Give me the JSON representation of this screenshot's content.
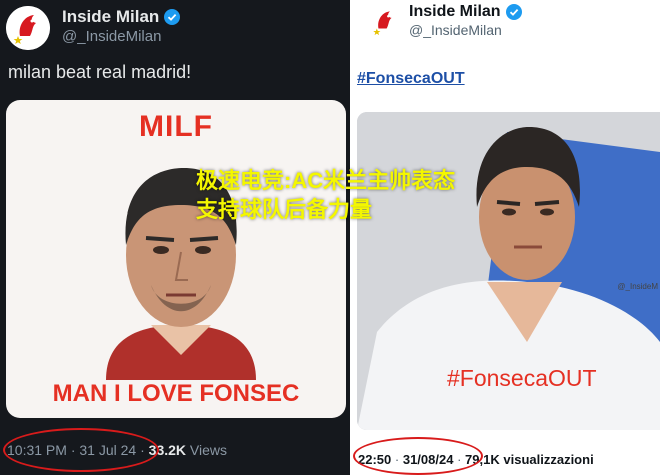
{
  "left_tweet": {
    "account_name": "Inside Milan",
    "handle": "@_InsideMilan",
    "text": "milan beat real madrid!",
    "meme_title": "MILF",
    "meme_caption": "MAN I LOVE FONSEC",
    "time": "10:31 PM",
    "separator": "·",
    "date": "31 Jul 24",
    "views_count": "33.2K",
    "views_label": "Views"
  },
  "right_tweet": {
    "account_name": "Inside Milan",
    "handle": "@_InsideMilan",
    "hashtag": "#FonsecaOUT",
    "photo_hashtag": "#FonsecaOUT",
    "watermark": "@_InsideM",
    "time": "22:50",
    "separator": "·",
    "date": "31/08/24",
    "views_count": "79,1K",
    "views_label": "visualizzazioni"
  },
  "overlay_text": "极速电竞:AC米兰主帅表态支持球队后备力量",
  "colors": {
    "dark_bg": "#15181d",
    "verified": "#1d9bf0",
    "meme_red": "#e53023",
    "hashtag_blue": "#1d4fa6",
    "overlay_yellow": "#f4f700",
    "annotation_red": "#d81b1b"
  },
  "icons": [
    "milan-logo-icon",
    "verified-badge-icon"
  ]
}
